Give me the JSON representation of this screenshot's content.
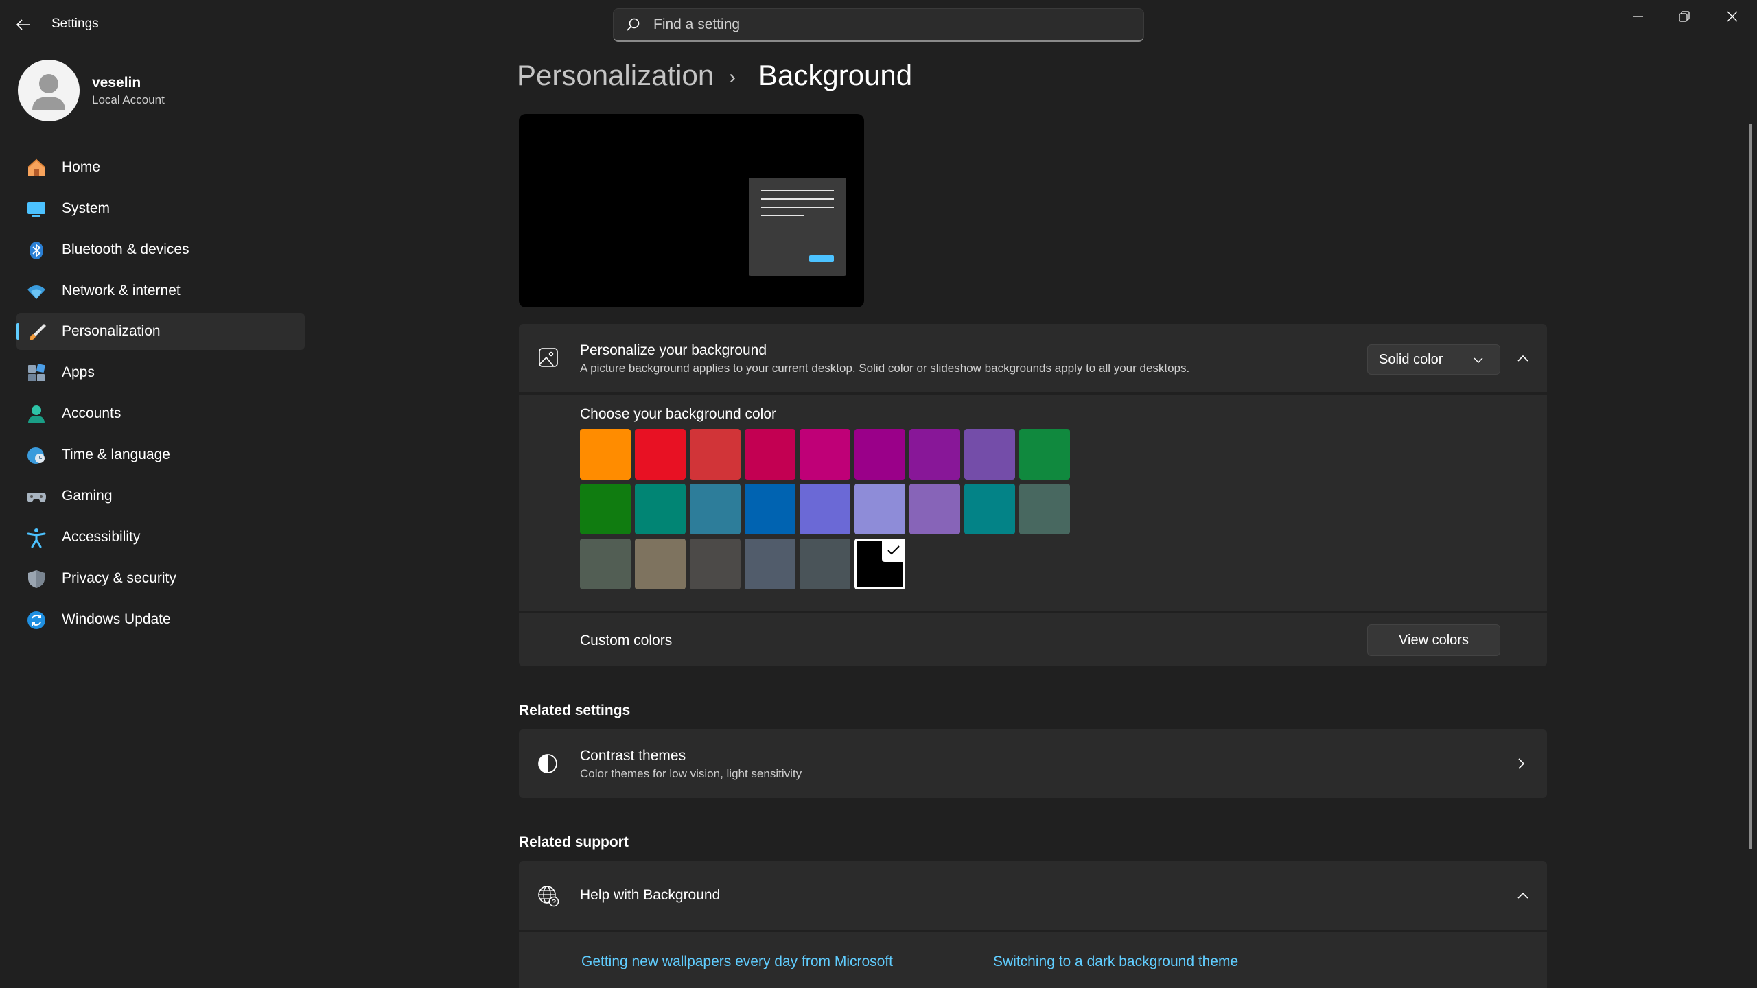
{
  "app": {
    "title": "Settings"
  },
  "search": {
    "placeholder": "Find a setting"
  },
  "profile": {
    "name": "veselin",
    "account_type": "Local Account"
  },
  "sidebar": {
    "items": [
      {
        "label": "Home",
        "icon": "home-icon"
      },
      {
        "label": "System",
        "icon": "system-icon"
      },
      {
        "label": "Bluetooth & devices",
        "icon": "bluetooth-icon"
      },
      {
        "label": "Network & internet",
        "icon": "wifi-icon"
      },
      {
        "label": "Personalization",
        "icon": "brush-icon",
        "active": true
      },
      {
        "label": "Apps",
        "icon": "apps-icon"
      },
      {
        "label": "Accounts",
        "icon": "accounts-icon"
      },
      {
        "label": "Time & language",
        "icon": "globe-clock-icon"
      },
      {
        "label": "Gaming",
        "icon": "gamepad-icon"
      },
      {
        "label": "Accessibility",
        "icon": "accessibility-icon"
      },
      {
        "label": "Privacy & security",
        "icon": "shield-icon"
      },
      {
        "label": "Windows Update",
        "icon": "update-icon"
      }
    ]
  },
  "breadcrumb": {
    "parent": "Personalization",
    "separator": "›",
    "current": "Background"
  },
  "background_card": {
    "title": "Personalize your background",
    "description": "A picture background applies to your current desktop. Solid color or slideshow backgrounds apply to all your desktops.",
    "dropdown_value": "Solid color"
  },
  "color_picker": {
    "label": "Choose your background color",
    "selected": "#000000",
    "colors": [
      [
        "#ff8c00",
        "#e81123",
        "#d13438",
        "#c30052",
        "#bf0077",
        "#9a0089",
        "#881798",
        "#744da9",
        "#10893e"
      ],
      [
        "#107c10",
        "#018574",
        "#2d7d9a",
        "#0063b1",
        "#6b69d6",
        "#8e8cd8",
        "#8764b8",
        "#038387",
        "#486860"
      ],
      [
        "#525e54",
        "#7e735f",
        "#4c4a48",
        "#515c6b",
        "#4a5459",
        "#000000"
      ]
    ]
  },
  "custom_colors": {
    "label": "Custom colors",
    "button": "View colors"
  },
  "related_settings": {
    "heading": "Related settings",
    "contrast": {
      "title": "Contrast themes",
      "sub": "Color themes for low vision, light sensitivity"
    }
  },
  "related_support": {
    "heading": "Related support",
    "help": {
      "title": "Help with Background",
      "links": [
        "Getting new wallpapers every day from Microsoft",
        "Switching to a dark background theme"
      ]
    }
  },
  "accent": "#60cdff"
}
